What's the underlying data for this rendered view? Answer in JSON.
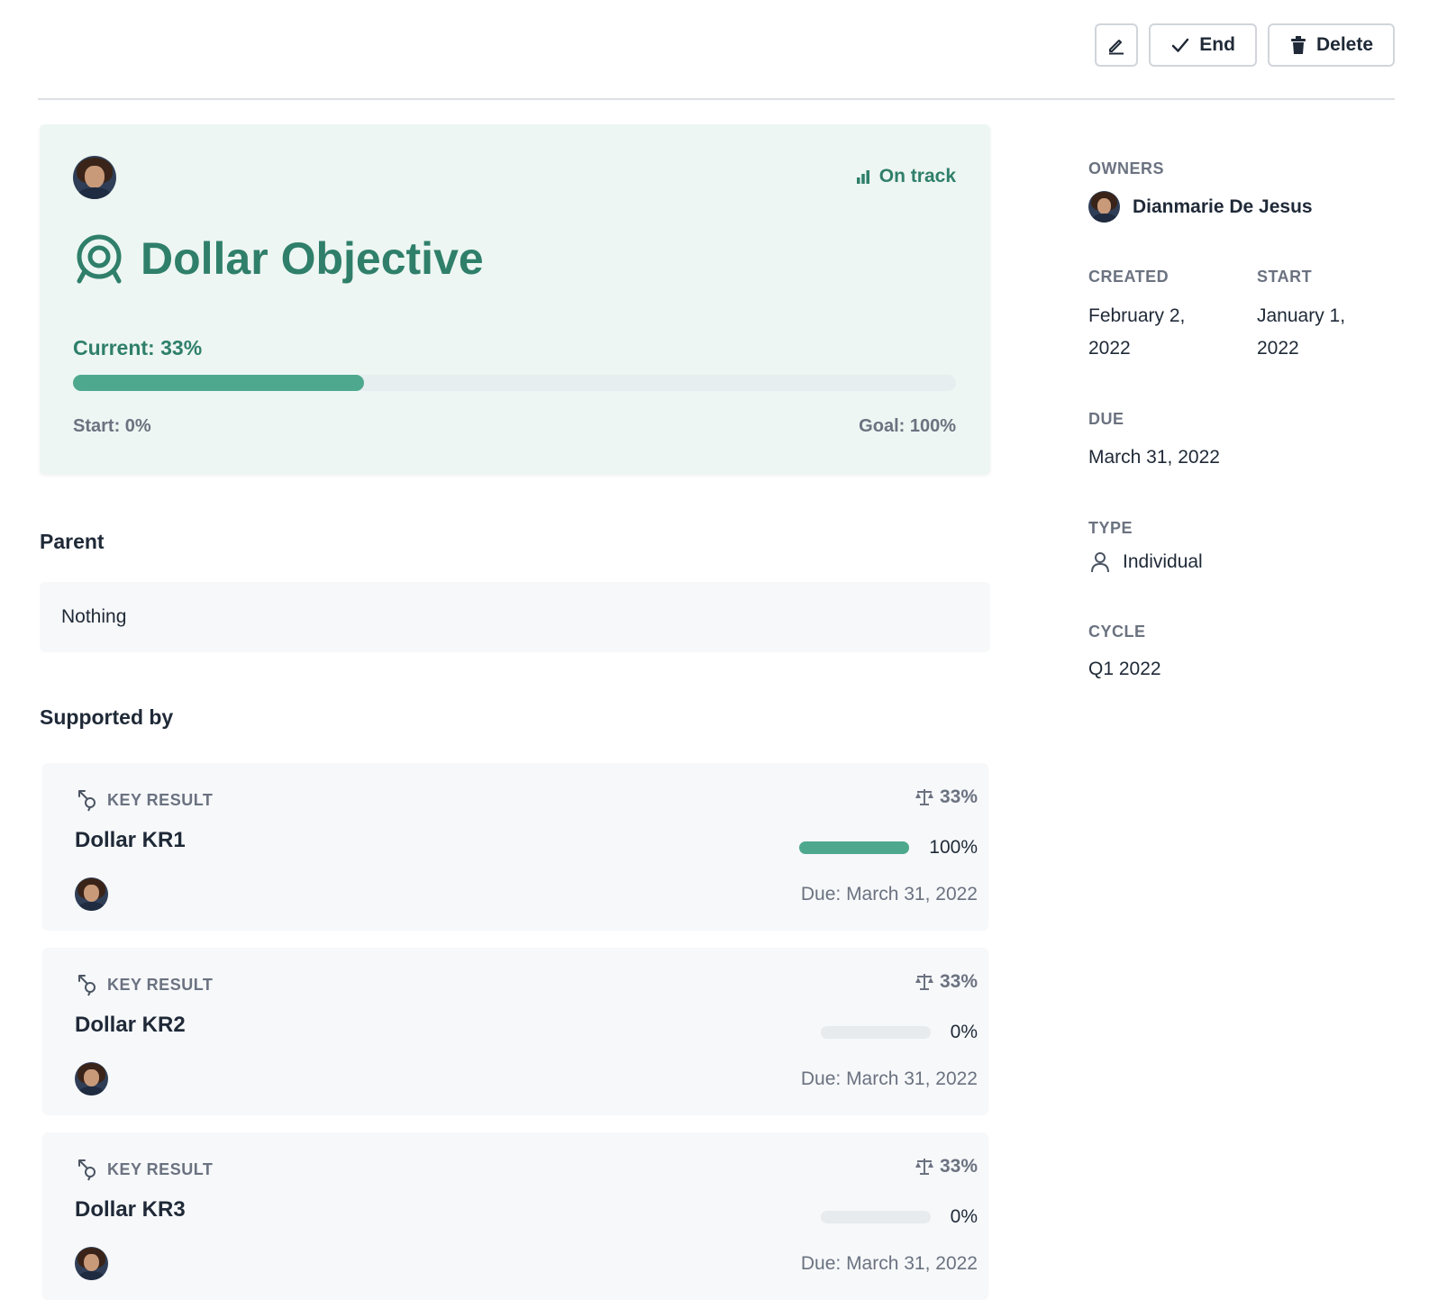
{
  "toolbar": {
    "edit_icon": "pencil-icon",
    "end_label": "End",
    "delete_label": "Delete"
  },
  "objective": {
    "status": "On track",
    "title": "Dollar Objective",
    "current_label": "Current: 33%",
    "progress_fraction": 0.33,
    "start_label": "Start: 0%",
    "goal_label": "Goal: 100%"
  },
  "parent": {
    "heading": "Parent",
    "value": "Nothing"
  },
  "supported_by": {
    "heading": "Supported by",
    "items": [
      {
        "tag": "KEY RESULT",
        "weight": "33%",
        "name": "Dollar KR1",
        "progress_label": "100%",
        "progress_fraction": 1.0,
        "due": "Due: March 31, 2022"
      },
      {
        "tag": "KEY RESULT",
        "weight": "33%",
        "name": "Dollar KR2",
        "progress_label": "0%",
        "progress_fraction": 0.0,
        "due": "Due: March 31, 2022"
      },
      {
        "tag": "KEY RESULT",
        "weight": "33%",
        "name": "Dollar KR3",
        "progress_label": "0%",
        "progress_fraction": 0.0,
        "due": "Due: March 31, 2022"
      }
    ]
  },
  "sidebar": {
    "owners_label": "OWNERS",
    "owner_name": "Dianmarie De Jesus",
    "created_label": "CREATED",
    "created_line1": "February 2,",
    "created_line2": "2022",
    "start_label": "START",
    "start_line1": "January 1,",
    "start_line2": "2022",
    "due_label": "DUE",
    "due_value": "March 31, 2022",
    "type_label": "TYPE",
    "type_value": "Individual",
    "cycle_label": "CYCLE",
    "cycle_value": "Q1 2022"
  },
  "colors": {
    "accent": "#2f7f6a",
    "progress_fill": "#4ea88e",
    "hero_bg": "#edf6f2"
  }
}
